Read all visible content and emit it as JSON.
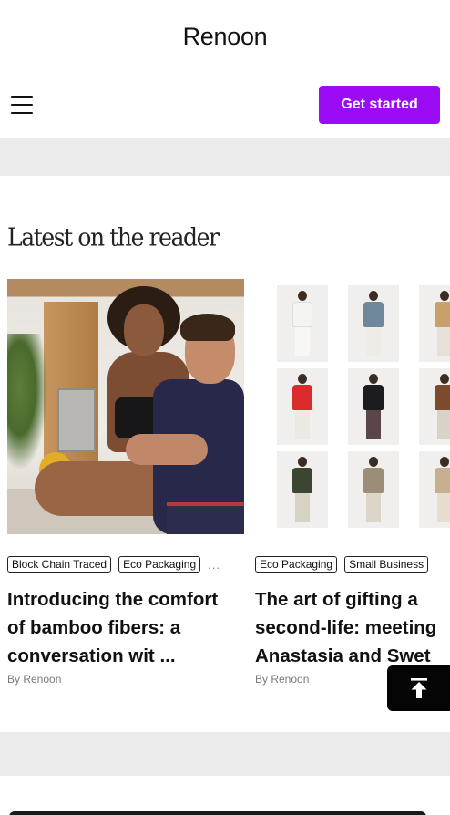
{
  "header": {
    "brand": "Renoon",
    "menu_icon": "hamburger-icon",
    "cta_label": "Get started",
    "cta_color": "#9b0bf5"
  },
  "section": {
    "title": "Latest on the reader"
  },
  "cards": [
    {
      "tags": [
        "Block Chain Traced",
        "Eco Packaging"
      ],
      "more": "...",
      "title_lines": [
        "Introducing the comfort",
        "of bamboo fibers: a",
        "conversation wit ..."
      ],
      "byline": "By Renoon"
    },
    {
      "tags": [
        "Eco Packaging",
        "Small Business"
      ],
      "title_lines": [
        "The art of gifting a",
        "second-life: meeting",
        "Anastasia and Swet"
      ],
      "byline": "By Renoon"
    }
  ],
  "scroll_top": {
    "icon": "arrow-up-to-top-icon"
  }
}
